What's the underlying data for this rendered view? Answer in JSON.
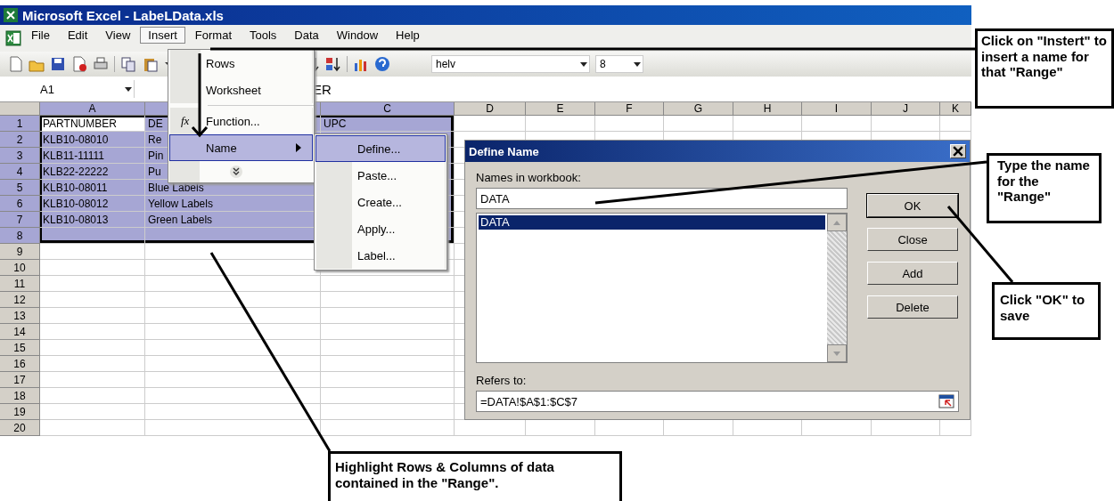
{
  "window": {
    "title": "Microsoft Excel - LabeLData.xls"
  },
  "menu_bar": [
    {
      "label": "File",
      "selected": false
    },
    {
      "label": "Edit",
      "selected": false
    },
    {
      "label": "View",
      "selected": false
    },
    {
      "label": "Insert",
      "selected": true
    },
    {
      "label": "Format",
      "selected": false
    },
    {
      "label": "Tools",
      "selected": false
    },
    {
      "label": "Data",
      "selected": false
    },
    {
      "label": "Window",
      "selected": false
    },
    {
      "label": "Help",
      "selected": false
    }
  ],
  "toolbar": {
    "font": "helv",
    "size": "8"
  },
  "formula_bar": {
    "name_box": "A1",
    "value": "ER"
  },
  "sheet": {
    "columns": [
      {
        "label": "A",
        "selected": true
      },
      {
        "selected": true
      },
      {
        "label": "C",
        "selected": true
      },
      {
        "label": "D",
        "selected": false
      },
      {
        "label": "E",
        "selected": false
      },
      {
        "label": "F",
        "selected": false
      },
      {
        "label": "G",
        "selected": false
      },
      {
        "label": "H",
        "selected": false
      },
      {
        "label": "I",
        "selected": false
      },
      {
        "label": "J",
        "selected": false
      },
      {
        "label": "K",
        "selected": false
      }
    ],
    "rows": [
      {
        "header": "1",
        "selected": true,
        "cells": [
          {
            "text": "PARTNUMBER",
            "active": true
          },
          {
            "text": "DE",
            "active": false
          },
          {
            "text": "UPC",
            "active": false
          }
        ]
      },
      {
        "header": "2",
        "selected": true,
        "cells": [
          {
            "text": "KLB10-08010",
            "active": false
          },
          {
            "text": "Re",
            "active": false
          }
        ]
      },
      {
        "header": "3",
        "selected": true,
        "cells": [
          {
            "text": "KLB11-11111",
            "active": false
          },
          {
            "text": "Pin",
            "active": false
          }
        ]
      },
      {
        "header": "4",
        "selected": true,
        "cells": [
          {
            "text": "KLB22-22222",
            "active": false
          },
          {
            "text": "Pu",
            "active": false
          }
        ]
      },
      {
        "header": "5",
        "selected": true,
        "cells": [
          {
            "text": "KLB10-08011",
            "active": false
          },
          {
            "text": "Blue Labels",
            "active": false
          }
        ]
      },
      {
        "header": "6",
        "selected": true,
        "cells": [
          {
            "text": "KLB10-08012",
            "active": false
          },
          {
            "text": "Yellow Labels",
            "active": false
          }
        ]
      },
      {
        "header": "7",
        "selected": true,
        "cells": [
          {
            "text": "KLB10-08013",
            "active": false
          },
          {
            "text": "Green Labels",
            "active": false
          }
        ]
      },
      {
        "header": "8",
        "selected": true
      },
      {
        "header": "9",
        "selected": false
      },
      {
        "header": "10",
        "selected": false
      },
      {
        "header": "11",
        "selected": false
      },
      {
        "header": "12",
        "selected": false
      },
      {
        "header": "13",
        "selected": false
      },
      {
        "header": "14",
        "selected": false
      },
      {
        "header": "15",
        "selected": false
      },
      {
        "header": "16",
        "selected": false
      },
      {
        "header": "17",
        "selected": false
      },
      {
        "header": "18",
        "selected": false
      },
      {
        "header": "19",
        "selected": false
      },
      {
        "header": "20",
        "selected": false
      }
    ]
  },
  "insert_menu": [
    {
      "kind": "item",
      "label": "Rows",
      "selected": false
    },
    {
      "kind": "item",
      "label": "Worksheet",
      "selected": false
    },
    {
      "kind": "separator"
    },
    {
      "kind": "item",
      "label": "Function...",
      "icon_text": "fx",
      "selected": false
    },
    {
      "kind": "submenu",
      "label": "Name",
      "selected": true
    },
    {
      "kind": "expand"
    }
  ],
  "name_submenu": [
    {
      "label": "Define...",
      "selected": true
    },
    {
      "label": "Paste...",
      "selected": false
    },
    {
      "label": "Create...",
      "selected": false
    },
    {
      "label": "Apply...",
      "selected": false
    },
    {
      "label": "Label...",
      "selected": false
    }
  ],
  "dialog": {
    "title": "Define Name",
    "names_label": "Names in workbook:",
    "name_value": "DATA",
    "names": [
      {
        "label": "DATA",
        "selected": true
      }
    ],
    "buttons": [
      {
        "label": "OK",
        "default": true
      },
      {
        "label": "Close",
        "default": false
      },
      {
        "label": "Add",
        "default": false
      },
      {
        "label": "Delete",
        "default": false
      }
    ],
    "refers_label": "Refers to:",
    "refers_value": "=DATA!$A$1:$C$7"
  },
  "callouts": [
    {
      "kind": "menu",
      "text": "Click on \"Instert\" to insert a name for that \"Range\""
    },
    {
      "kind": "name",
      "text": "Type the name for the \"Range\""
    },
    {
      "kind": "ok",
      "text": "Click \"OK\" to save"
    },
    {
      "kind": "range",
      "text": "Highlight Rows & Columns of data contained in the \"Range\"."
    }
  ]
}
